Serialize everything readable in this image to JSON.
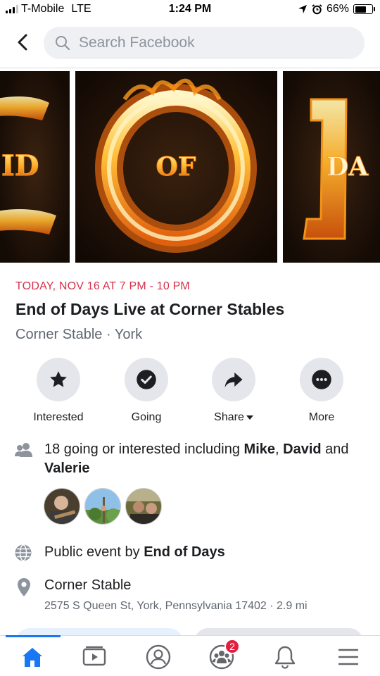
{
  "status_bar": {
    "carrier": "T-Mobile",
    "network": "LTE",
    "time": "1:24 PM",
    "battery": "66%",
    "battery_level": 0.66
  },
  "header": {
    "back_icon": "chevron-left-icon",
    "search_placeholder": "Search Facebook"
  },
  "cover": {
    "tiles": [
      "ID",
      "OF",
      "DA"
    ]
  },
  "event": {
    "date": "TODAY, NOV 16 AT 7 PM - 10 PM",
    "title": "End of Days Live at Corner Stables",
    "location_line": "Corner Stable · York"
  },
  "actions": [
    {
      "label": "Interested",
      "icon": "star-icon"
    },
    {
      "label": "Going",
      "icon": "check-icon"
    },
    {
      "label": "Share",
      "icon": "share-arrow-icon"
    },
    {
      "label": "More",
      "icon": "ellipsis-icon"
    }
  ],
  "attendance": {
    "prefix": "18 going or interested including ",
    "name1": "Mike",
    "sep": ", ",
    "name2": "David",
    "and": " and ",
    "name3": "Valerie"
  },
  "privacy": {
    "prefix": "Public event by ",
    "host": "End of Days"
  },
  "venue": {
    "name": "Corner Stable",
    "address": "2575 S Queen St, York, Pennsylvania 17402 · 2.9 mi"
  },
  "tabbar": {
    "tabs": [
      "home-icon",
      "watch-icon",
      "profile-icon",
      "groups-icon",
      "notifications-icon",
      "menu-icon"
    ],
    "groups_badge": "2"
  },
  "colors": {
    "accent": "#1877f2",
    "date_red": "#d4314b",
    "badge_red": "#e41e3f"
  }
}
